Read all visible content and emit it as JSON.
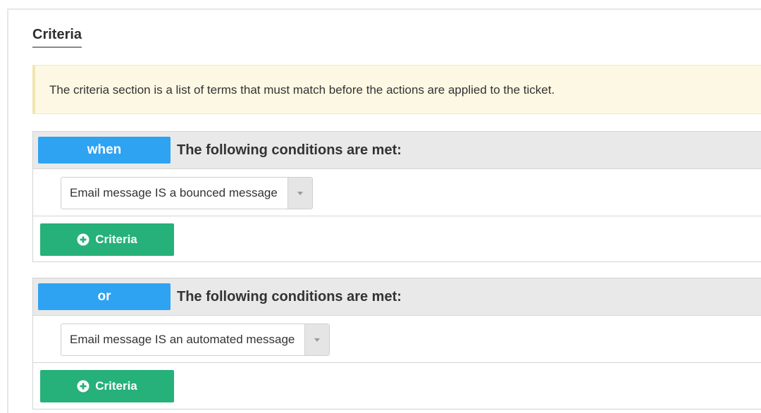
{
  "section": {
    "title": "Criteria"
  },
  "notice": {
    "text": "The criteria section is a list of terms that must match before the actions are applied to the ticket."
  },
  "groups": [
    {
      "conjunction": "when",
      "heading": "The following conditions are met:",
      "condition": "Email message IS a bounced message",
      "add_label": "Criteria"
    },
    {
      "conjunction": "or",
      "heading": "The following conditions are met:",
      "condition": "Email message IS an automated message",
      "add_label": "Criteria"
    }
  ],
  "icons": {
    "add": "plus-circle-icon",
    "dropdown": "chevron-down-icon"
  },
  "colors": {
    "conjunction_badge": "#2ea3f2",
    "add_button": "#26b07a",
    "notice_background": "#fcf8e3",
    "group_header": "#e9e9e9"
  }
}
